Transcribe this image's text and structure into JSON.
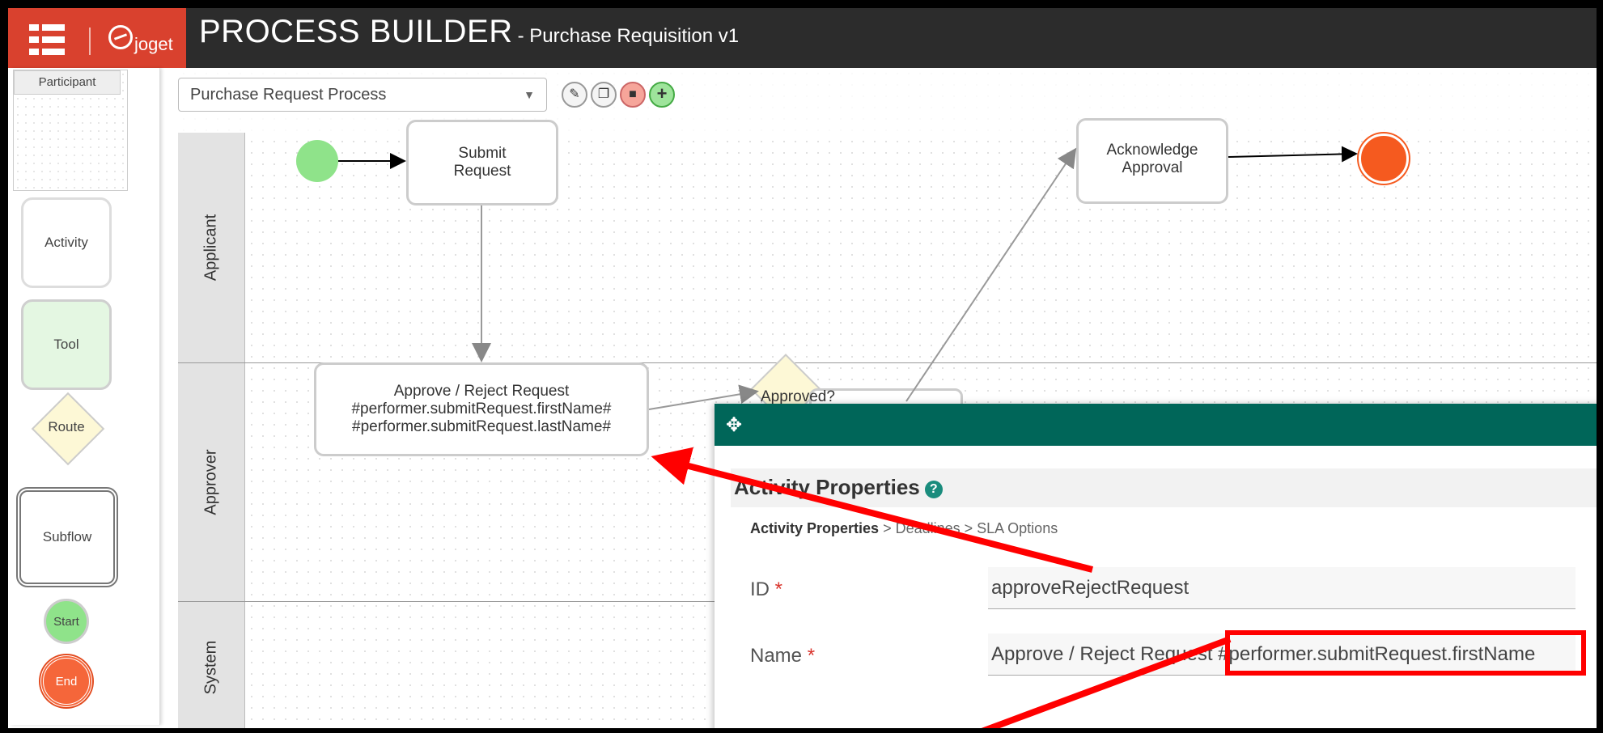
{
  "header": {
    "logo_text": "joget",
    "title": "PROCESS BUILDER",
    "subtitle": "- Purchase Requisition v1"
  },
  "palette": {
    "participant": "Participant",
    "activity": "Activity",
    "tool": "Tool",
    "route": "Route",
    "subflow": "Subflow",
    "start": "Start",
    "end": "End"
  },
  "toolbar": {
    "process_select": "Purchase Request Process",
    "edit_icon": "pencil-icon",
    "copy_icon": "copy-icon",
    "delete_icon": "trash-icon",
    "add_icon": "plus-icon"
  },
  "lanes": [
    "Applicant",
    "Approver",
    "System"
  ],
  "nodes": {
    "submit_request": [
      "Submit",
      "Request"
    ],
    "acknowledge_approval": [
      "Acknowledge",
      "Approval"
    ],
    "approve_reject": [
      "Approve / Reject Request",
      "#performer.submitRequest.firstName#",
      "#performer.submitRequest.lastName#"
    ],
    "route_label": "Approved?"
  },
  "dialog": {
    "title": "Activity Properties",
    "breadcrumb_current": "Activity Properties",
    "breadcrumb_rest": " > Deadlines > SLA Options",
    "id_label": "ID",
    "id_value": "approveRejectRequest",
    "name_label": "Name",
    "name_value": "Approve / Reject Request #performer.submitRequest.firstName",
    "required_mark": "*"
  },
  "colors": {
    "header_bg": "#2c2c2c",
    "logo_bg": "#d9412e",
    "dialog_bar": "#006659",
    "annotation": "#ff0000",
    "start": "#8fe38a",
    "end": "#f55a1f"
  }
}
